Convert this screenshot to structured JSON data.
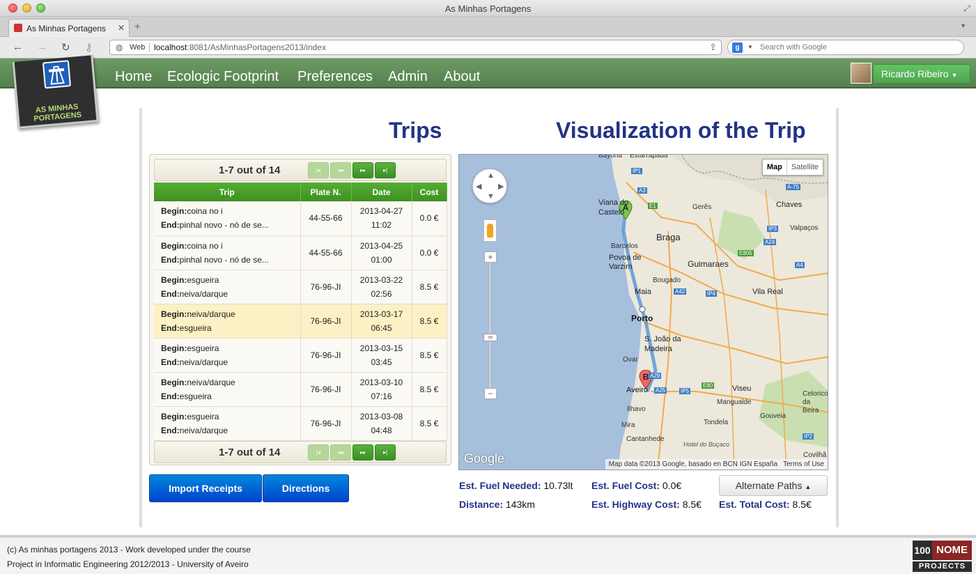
{
  "browser": {
    "window_title": "As Minhas Portagens",
    "tab_label": "As Minhas Portagens",
    "url_scheme_label": "Web",
    "url_host": "localhost",
    "url_path": ":8081/AsMinhasPortagens2013/index",
    "search_placeholder": "Search with Google",
    "search_engine_icon": "g"
  },
  "nav": {
    "logo_text": "AS MINHAS PORTAGENS",
    "items": [
      "Home",
      "Ecologic Footprint",
      "Preferences",
      "Admin",
      "About"
    ],
    "user_name": "Ricardo Ribeiro"
  },
  "trips": {
    "title": "Trips",
    "pager_label": "1-7 out of 14",
    "pager_buttons": [
      "|◂",
      "◂◂",
      "▸▸",
      "▸|"
    ],
    "columns": [
      "Trip",
      "Plate N.",
      "Date",
      "Cost"
    ],
    "begin_label": "Begin:",
    "end_label": "End:",
    "rows": [
      {
        "begin": "coina no i",
        "end": "pinhal novo - nó de se...",
        "plate": "44-55-66",
        "date": "2013-04-27",
        "time": "11:02",
        "cost": "0.0 €"
      },
      {
        "begin": "coina no i",
        "end": "pinhal novo - nó de se...",
        "plate": "44-55-66",
        "date": "2013-04-25",
        "time": "01:00",
        "cost": "0.0 €"
      },
      {
        "begin": "esgueira",
        "end": "neiva/darque",
        "plate": "76-96-JI",
        "date": "2013-03-22",
        "time": "02:56",
        "cost": "8.5 €"
      },
      {
        "begin": "neiva/darque",
        "end": "esgueira",
        "plate": "76-96-JI",
        "date": "2013-03-17",
        "time": "06:45",
        "cost": "8.5 €"
      },
      {
        "begin": "esgueira",
        "end": "neiva/darque",
        "plate": "76-96-JI",
        "date": "2013-03-15",
        "time": "03:45",
        "cost": "8.5 €"
      },
      {
        "begin": "neiva/darque",
        "end": "esgueira",
        "plate": "76-96-JI",
        "date": "2013-03-10",
        "time": "07:16",
        "cost": "8.5 €"
      },
      {
        "begin": "esgueira",
        "end": "neiva/darque",
        "plate": "76-96-JI",
        "date": "2013-03-08",
        "time": "04:48",
        "cost": "8.5 €"
      }
    ],
    "import_button": "Import Receipts",
    "directions_button": "Directions"
  },
  "visualization": {
    "title": "Visualization of the Trip",
    "map_type_map": "Map",
    "map_type_satellite": "Satellite",
    "google_logo": "Google",
    "attribution": "Map data ©2013 Google, basado en BCN IGN España",
    "terms": "Terms of Use",
    "marker_a": "A",
    "marker_b": "B",
    "places": [
      "Bayona",
      "Estarrapada",
      "Viana do Castelo",
      "Braga",
      "Chaves",
      "Gerês",
      "Valpaços",
      "Barcelos",
      "Povoa de Varzim",
      "Guimaraes",
      "Bougado",
      "Maia",
      "Vila Real",
      "Porto",
      "S. João da Madeira",
      "Ovar",
      "Aveiro",
      "Viseu",
      "Ilhavo",
      "Mangualde",
      "Gouveia",
      "Mira",
      "Tondela",
      "Cantanhede",
      "Hotel do Buçaco",
      "Celorico da Beira",
      "Covilhã"
    ],
    "roads": [
      "IP1",
      "A3",
      "E1",
      "A-75",
      "IP3",
      "A24",
      "E805",
      "A4",
      "A42",
      "IP4",
      "A29",
      "A25",
      "IP5",
      "E80",
      "IP2"
    ],
    "fuel_needed_label": "Est. Fuel Needed:",
    "fuel_needed_value": "10.73lt",
    "fuel_cost_label": "Est. Fuel Cost:",
    "fuel_cost_value": "0.0€",
    "alt_paths_button": "Alternate Paths",
    "distance_label": "Distance:",
    "distance_value": "143km",
    "highway_cost_label": "Est. Highway Cost:",
    "highway_cost_value": "8.5€",
    "total_cost_label": "Est. Total Cost:",
    "total_cost_value": "8.5€"
  },
  "footer": {
    "line1": "(c) As minhas portagens 2013 - Work developed under the course",
    "line2": "Project in Informatic Engineering 2012/2013 - University of Aveiro",
    "logo_100": "100",
    "logo_nome": "NOME",
    "logo_projects": "PROJECTS"
  },
  "colors": {
    "nav_green": "#6c9b63",
    "title_blue": "#223385",
    "table_header_green": "#4a9e2b",
    "primary_blue": "#0055cc",
    "highlight_row": "#fcf1c4"
  }
}
